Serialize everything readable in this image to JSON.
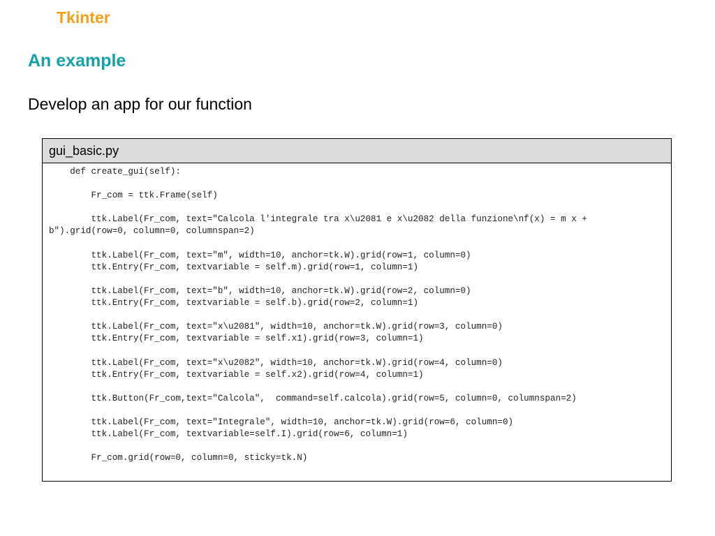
{
  "header": {
    "title": "Tkinter",
    "title_color": "#f5a01a"
  },
  "section": {
    "heading": "An example",
    "heading_color": "#16a1a8",
    "subtitle": "Develop an app for our function"
  },
  "code_panel": {
    "filename": "gui_basic.py",
    "lines": [
      "    def create_gui(self):",
      "",
      "        Fr_com = ttk.Frame(self)",
      "",
      "        ttk.Label(Fr_com, text=\"Calcola l'integrale tra x\\u2081 e x\\u2082 della funzione\\nf(x) = m x +",
      "b\").grid(row=0, column=0, columnspan=2)",
      "",
      "        ttk.Label(Fr_com, text=\"m\", width=10, anchor=tk.W).grid(row=1, column=0)",
      "        ttk.Entry(Fr_com, textvariable = self.m).grid(row=1, column=1)",
      "",
      "        ttk.Label(Fr_com, text=\"b\", width=10, anchor=tk.W).grid(row=2, column=0)",
      "        ttk.Entry(Fr_com, textvariable = self.b).grid(row=2, column=1)",
      "",
      "        ttk.Label(Fr_com, text=\"x\\u2081\", width=10, anchor=tk.W).grid(row=3, column=0)",
      "        ttk.Entry(Fr_com, textvariable = self.x1).grid(row=3, column=1)",
      "",
      "        ttk.Label(Fr_com, text=\"x\\u2082\", width=10, anchor=tk.W).grid(row=4, column=0)",
      "        ttk.Entry(Fr_com, textvariable = self.x2).grid(row=4, column=1)",
      "",
      "        ttk.Button(Fr_com,text=\"Calcola\",  command=self.calcola).grid(row=5, column=0, columnspan=2)",
      "",
      "        ttk.Label(Fr_com, text=\"Integrale\", width=10, anchor=tk.W).grid(row=6, column=0)",
      "        ttk.Label(Fr_com, textvariable=self.I).grid(row=6, column=1)",
      "",
      "        Fr_com.grid(row=0, column=0, sticky=tk.N)"
    ]
  }
}
